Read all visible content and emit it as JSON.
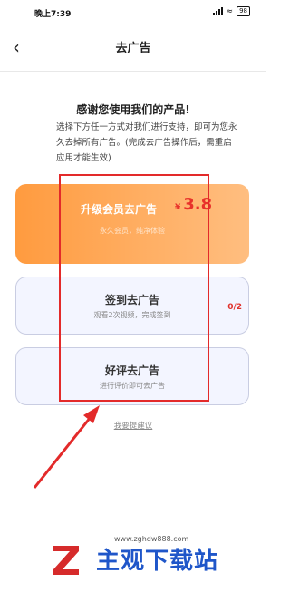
{
  "status_bar": {
    "time": "晚上7:39",
    "battery": "98"
  },
  "nav": {
    "title": "去广告"
  },
  "intro": {
    "heading": "感谢您使用我们的产品!",
    "description": "选择下方任一方式对我们进行支持，即可为您永久去掉所有广告。(完成去广告操作后，需重启应用才能生效)"
  },
  "options": {
    "vip": {
      "title": "升级会员去广告",
      "subtitle": "永久会员，纯净体验",
      "currency": "¥",
      "price": "3.8"
    },
    "sign": {
      "title": "签到去广告",
      "subtitle": "观看2次视频，完成签到",
      "progress": "0/2"
    },
    "review": {
      "title": "好评去广告",
      "subtitle": "进行评价即可去广告"
    }
  },
  "feedback_link": "我要提建议",
  "watermark": {
    "site_name": "主观下载站",
    "url": "www.zghdw888.com"
  },
  "colors": {
    "accent_red": "#e32a2a",
    "vip_orange": "#ff9b3f",
    "brand_blue": "#1f56c9"
  }
}
